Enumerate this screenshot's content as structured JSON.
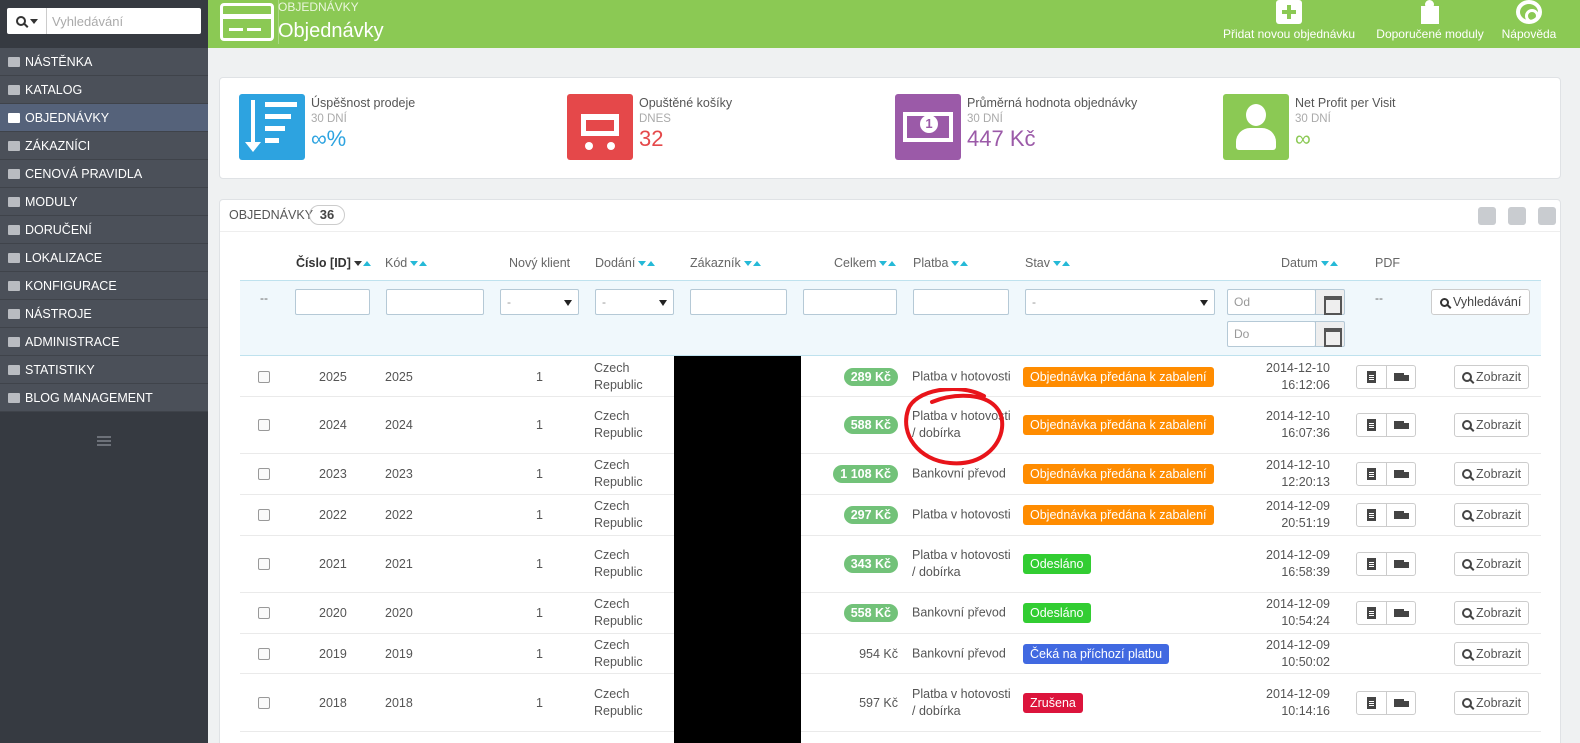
{
  "sidebar": {
    "search_placeholder": "Vyhledávání",
    "items": [
      {
        "label": "NÁSTĚNKA",
        "icon": "dashboard-icon"
      },
      {
        "label": "KATALOG",
        "icon": "book-icon"
      },
      {
        "label": "OBJEDNÁVKY",
        "icon": "credit-card-icon",
        "active": true
      },
      {
        "label": "ZÁKAZNÍCI",
        "icon": "users-icon"
      },
      {
        "label": "CENOVÁ PRAVIDLA",
        "icon": "tags-icon"
      },
      {
        "label": "MODULY",
        "icon": "puzzle-icon"
      },
      {
        "label": "DORUČENÍ",
        "icon": "truck-icon"
      },
      {
        "label": "LOKALIZACE",
        "icon": "globe-icon"
      },
      {
        "label": "KONFIGURACE",
        "icon": "wrench-icon"
      },
      {
        "label": "NÁSTROJE",
        "icon": "cogs-icon"
      },
      {
        "label": "ADMINISTRACE",
        "icon": "gear-icon"
      },
      {
        "label": "STATISTIKY",
        "icon": "bar-chart-icon"
      },
      {
        "label": "BLOG MANAGEMENT",
        "icon": "pencil-icon"
      }
    ]
  },
  "header": {
    "breadcrumb": "OBJEDNÁVKY",
    "title": "Objednávky",
    "buttons": [
      {
        "label": "Přidat novou objednávku",
        "icon": "plus-icon"
      },
      {
        "label": "Doporučené moduly",
        "icon": "puzzle-icon"
      },
      {
        "label": "Nápověda",
        "icon": "lifebuoy-icon"
      }
    ]
  },
  "kpis": [
    {
      "title": "Úspěšnost prodeje",
      "sub": "30 DNÍ",
      "value": "∞%",
      "color": "#2da3e0"
    },
    {
      "title": "Opuštěné košíky",
      "sub": "DNES",
      "value": "32",
      "color": "#e5484a"
    },
    {
      "title": "Průměrná hodnota objednávky",
      "sub": "30 DNÍ",
      "value": "447 Kč",
      "color": "#9b5aa8"
    },
    {
      "title": "Net Profit per Visit",
      "sub": "30 DNÍ",
      "value": "∞",
      "color": "#8bc954"
    }
  ],
  "orders": {
    "title": "OBJEDNÁVKY",
    "count": "36",
    "columns": {
      "id": "Číslo [ID]",
      "code": "Kód",
      "new_client": "Nový klient",
      "delivery": "Dodání",
      "customer": "Zákazník",
      "total": "Celkem",
      "payment": "Platba",
      "status": "Stav",
      "date": "Datum",
      "pdf": "PDF"
    },
    "filters": {
      "dash": "--",
      "select_default": "-",
      "date_from": "Od",
      "date_to": "Do",
      "pdf_dash": "--",
      "search_button": "Vyhledávání"
    },
    "view_label": "Zobrazit",
    "rows": [
      {
        "id": "2025",
        "code": "2025",
        "new": "1",
        "delivery": "Czech Republic",
        "total": "289 Kč",
        "badge": true,
        "payment": "Platba v hotovosti",
        "status": "Objednávka předána k zabalení",
        "status_color": "#ff8c00",
        "date": "2014-12-10",
        "time": "16:12:06",
        "pdf": true
      },
      {
        "id": "2024",
        "code": "2024",
        "new": "1",
        "delivery": "Czech Republic",
        "total": "588 Kč",
        "badge": true,
        "payment": "Platba v hotovosti / dobírka",
        "status": "Objednávka předána k zabalení",
        "status_color": "#ff8c00",
        "date": "2014-12-10",
        "time": "16:07:36",
        "pdf": true
      },
      {
        "id": "2023",
        "code": "2023",
        "new": "1",
        "delivery": "Czech Republic",
        "total": "1 108 Kč",
        "badge": true,
        "payment": "Bankovní převod",
        "status": "Objednávka předána k zabalení",
        "status_color": "#ff8c00",
        "date": "2014-12-10",
        "time": "12:20:13",
        "pdf": true
      },
      {
        "id": "2022",
        "code": "2022",
        "new": "1",
        "delivery": "Czech Republic",
        "total": "297 Kč",
        "badge": true,
        "payment": "Platba v hotovosti",
        "status": "Objednávka předána k zabalení",
        "status_color": "#ff8c00",
        "date": "2014-12-09",
        "time": "20:51:19",
        "pdf": true
      },
      {
        "id": "2021",
        "code": "2021",
        "new": "1",
        "delivery": "Czech Republic",
        "total": "343 Kč",
        "badge": true,
        "payment": "Platba v hotovosti / dobírka",
        "status": "Odesláno",
        "status_color": "#32cd32",
        "date": "2014-12-09",
        "time": "16:58:39",
        "pdf": true
      },
      {
        "id": "2020",
        "code": "2020",
        "new": "1",
        "delivery": "Czech Republic",
        "total": "558 Kč",
        "badge": true,
        "payment": "Bankovní převod",
        "status": "Odesláno",
        "status_color": "#32cd32",
        "date": "2014-12-09",
        "time": "10:54:24",
        "pdf": true
      },
      {
        "id": "2019",
        "code": "2019",
        "new": "1",
        "delivery": "Czech Republic",
        "total": "954 Kč",
        "badge": false,
        "payment": "Bankovní převod",
        "status": "Čeká na příchozí platbu",
        "status_color": "#4169e1",
        "date": "2014-12-09",
        "time": "10:50:02",
        "pdf": false
      },
      {
        "id": "2018",
        "code": "2018",
        "new": "1",
        "delivery": "Czech Republic",
        "total": "597 Kč",
        "badge": false,
        "payment": "Platba v hotovosti / dobírka",
        "status": "Zrušena",
        "status_color": "#dc143c",
        "date": "2014-12-09",
        "time": "10:14:16",
        "pdf": true
      }
    ]
  }
}
